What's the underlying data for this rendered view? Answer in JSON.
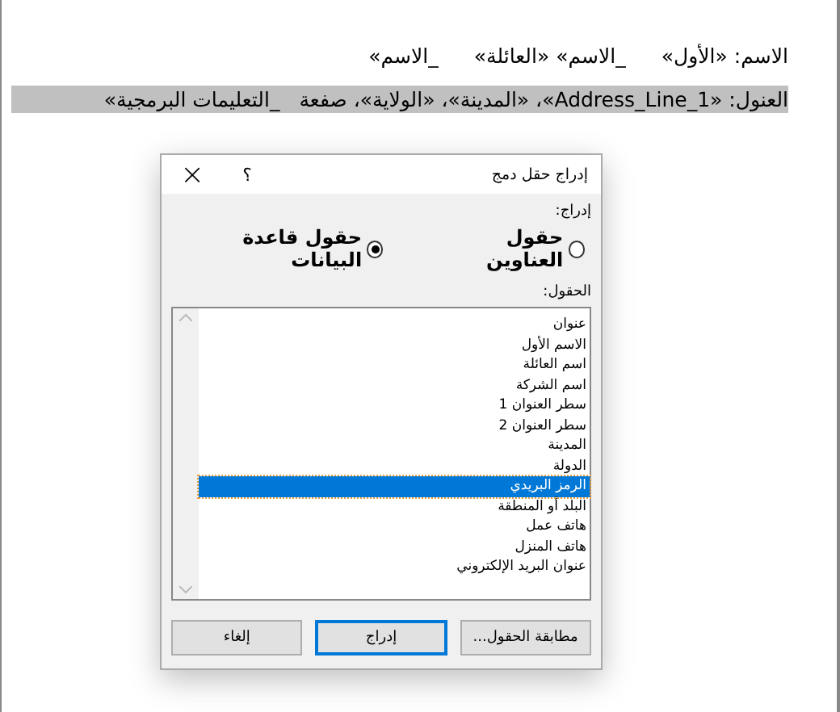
{
  "document": {
    "lines": [
      {
        "parts": [
          "الاسم: «الأول»",
          "_الاسم» «العائلة»",
          "_الاسم»"
        ],
        "selected": false
      },
      {
        "parts": [
          "العنول: «Address_Line_1»، «المدينة»، «الولاية»، صفعة",
          "_التعليمات البرمجية»"
        ],
        "selected": true
      }
    ]
  },
  "dialog": {
    "title": "إدراج حقل دمج",
    "help": "؟",
    "close": "×",
    "insert_label": "إدراج:",
    "radios": [
      {
        "label": "حقول العناوين",
        "selected": false
      },
      {
        "label": "حقول قاعدة البيانات",
        "selected": true
      }
    ],
    "fields_label": "الحقول:",
    "fields": [
      {
        "label": "عنوان",
        "selected": false
      },
      {
        "label": "الاسم الأول",
        "selected": false
      },
      {
        "label": "اسم العائلة",
        "selected": false
      },
      {
        "label": "اسم الشركة",
        "selected": false
      },
      {
        "label": "سطر العنوان 1",
        "selected": false
      },
      {
        "label": "سطر العنوان 2",
        "selected": false
      },
      {
        "label": "المدينة",
        "selected": false
      },
      {
        "label": "الدولة",
        "selected": false
      },
      {
        "label": "الرمز البريدي",
        "selected": true
      },
      {
        "label": "البلد أو المنطقة",
        "selected": false
      },
      {
        "label": "هاتف عمل",
        "selected": false
      },
      {
        "label": "هاتف المنزل",
        "selected": false
      },
      {
        "label": "عنوان البريد الإلكتروني",
        "selected": false
      }
    ],
    "buttons": [
      {
        "label": "مطابقة الحقول...",
        "default": false
      },
      {
        "label": "إدراج",
        "default": true
      },
      {
        "label": "إلغاء",
        "default": false
      }
    ]
  }
}
